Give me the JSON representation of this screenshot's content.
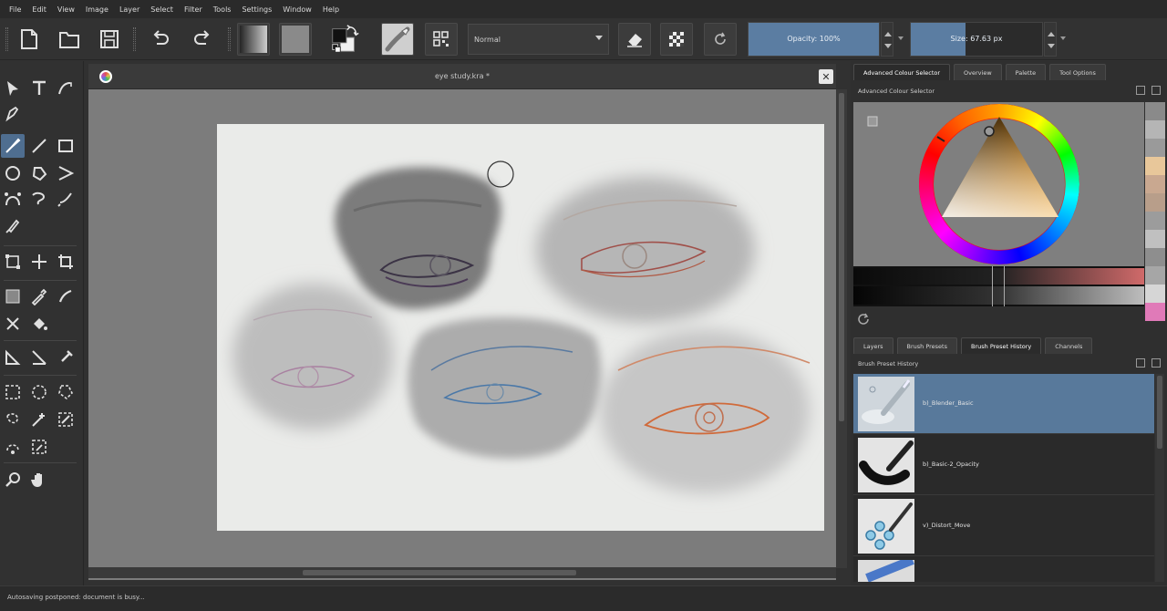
{
  "menu": [
    "File",
    "Edit",
    "View",
    "Image",
    "Layer",
    "Select",
    "Filter",
    "Tools",
    "Settings",
    "Window",
    "Help"
  ],
  "toolbar": {
    "blend_mode": "Normal",
    "opacity_label": "Opacity: 100%",
    "opacity_value": 1.0,
    "size_label": "Size: 67.63 px",
    "icons": [
      "new-document-icon",
      "open-folder-icon",
      "save-icon",
      "undo-icon",
      "redo-icon",
      "gradient-icon",
      "pattern-icon",
      "fg-bg-color-icon",
      "brush-preset-icon",
      "presets-grid-icon",
      "eraser-icon",
      "alpha-lock-icon",
      "reload-preset-icon"
    ]
  },
  "toolbox": {
    "active_tool": "freehand-brush-tool",
    "tools": [
      "select-shapes-tool",
      "text-tool",
      "calligraphy-tool",
      "edit-shapes-tool",
      "freehand-brush-tool",
      "line-tool",
      "rectangle-tool",
      "ellipse-tool",
      "polygon-tool",
      "polyline-tool",
      "bezier-curve-tool",
      "freehand-path-tool",
      "dynamic-brush-tool",
      "multibrush-tool",
      "transform-tool",
      "move-tool",
      "crop-tool",
      "gradient-tool",
      "color-picker-tool",
      "smart-patch-tool",
      "colorize-mask-tool",
      "fill-tool",
      "assistant-tool",
      "measure-tool",
      "reference-images-tool",
      "rectangular-selection-tool",
      "elliptical-selection-tool",
      "polygonal-selection-tool",
      "freehand-selection-tool",
      "contiguous-selection-tool",
      "similar-color-selection-tool",
      "bezier-selection-tool",
      "magnetic-selection-tool",
      "zoom-tool",
      "pan-tool"
    ]
  },
  "document": {
    "title": "eye study.kra *"
  },
  "dock": {
    "top_tabs": [
      "Advanced Colour Selector",
      "Overview",
      "Palette",
      "Tool Options"
    ],
    "top_active": "Advanced Colour Selector",
    "color_panel_title": "Advanced Colour Selector",
    "palette_colors": [
      "#8a8a8a",
      "#b5b5b5",
      "#9a9a9a",
      "#e8c79a",
      "#c9a890",
      "#b89e8a",
      "#9c9c9c",
      "#c0c0c0",
      "#8e8e8e",
      "#a6a6a6",
      "#d6d6d6",
      "#e07ab8"
    ],
    "bottom_tabs": [
      "Layers",
      "Brush Presets",
      "Brush Preset History",
      "Channels"
    ],
    "bottom_active": "Brush Preset History",
    "history_title": "Brush Preset History",
    "presets": [
      {
        "name": "b)_Blender_Basic",
        "selected": true
      },
      {
        "name": "b)_Basic-2_Opacity",
        "selected": false
      },
      {
        "name": "v)_Distort_Move",
        "selected": false
      },
      {
        "name": "",
        "selected": false
      }
    ]
  },
  "status": {
    "text": "Autosaving postponed: document is busy..."
  }
}
